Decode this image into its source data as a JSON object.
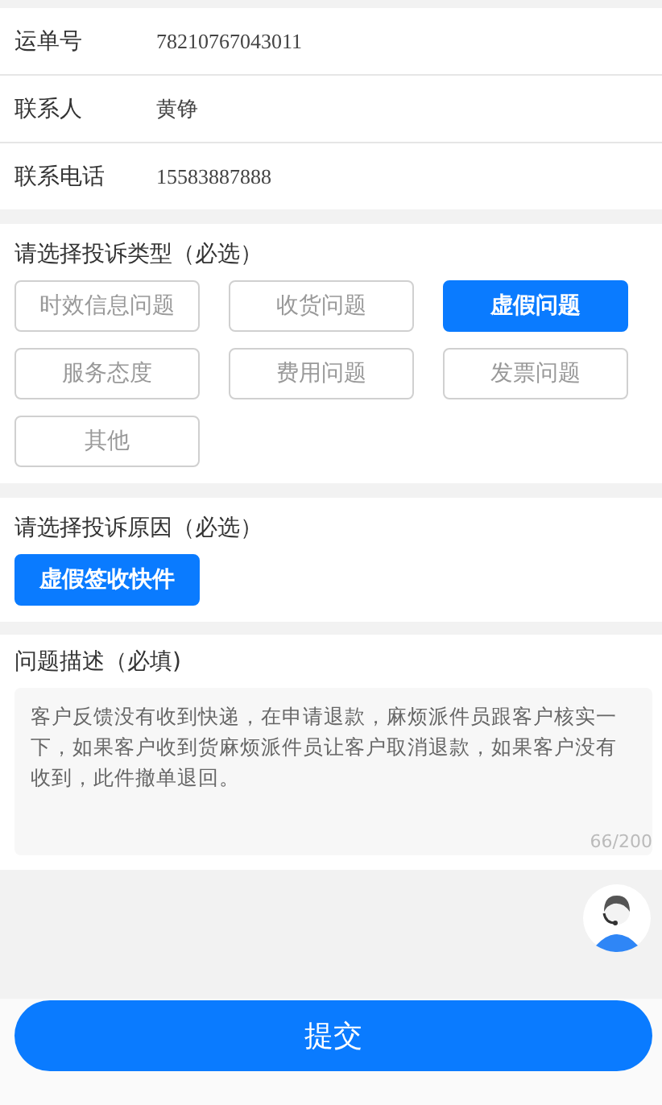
{
  "info_rows": [
    {
      "label": "运单号",
      "value": "78210767043011"
    },
    {
      "label": "联系人",
      "value": "黄铮"
    },
    {
      "label": "联系电话",
      "value": "15583887888"
    }
  ],
  "complaint_type": {
    "title": "请选择投诉类型（必选）",
    "options": [
      {
        "label": "时效信息问题",
        "selected": false
      },
      {
        "label": "收货问题",
        "selected": false
      },
      {
        "label": "虚假问题",
        "selected": true
      },
      {
        "label": "服务态度",
        "selected": false
      },
      {
        "label": "费用问题",
        "selected": false
      },
      {
        "label": "发票问题",
        "selected": false
      },
      {
        "label": "其他",
        "selected": false
      }
    ]
  },
  "complaint_reason": {
    "title": "请选择投诉原因（必选）",
    "options": [
      {
        "label": "虚假签收快件",
        "selected": true
      }
    ]
  },
  "description": {
    "title": "问题描述（必填)",
    "value": "客户反馈没有收到快递，在申请退款，麻烦派件员跟客户核实一下，如果客户收到货麻烦派件员让客户取消退款，如果客户没有收到，此件撤单退回。",
    "counter": "66/200"
  },
  "submit_button": "提交"
}
